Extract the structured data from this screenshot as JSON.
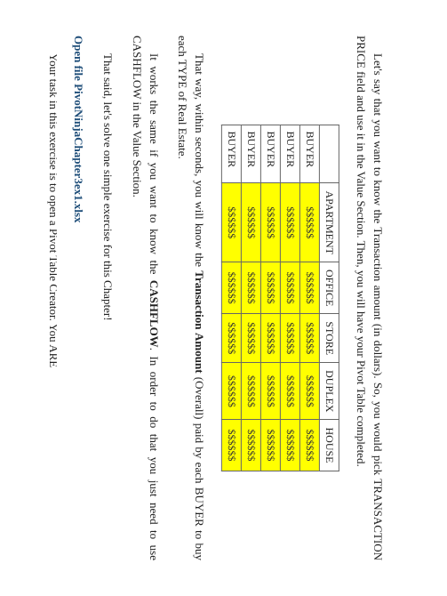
{
  "para1": "Let's say that you want to know the Transaction amount (in dollars). So, you would pick TRANSACTION PRICE field and use it in the Value Section. Then, you will have your Pivot Table completed.",
  "table": {
    "headers": [
      "",
      "APARTMENT",
      "OFFICE",
      "STORE",
      "DUPLEX",
      "HOUSE"
    ],
    "rowLabel": "BUYER",
    "cellValue": "$$$$$$",
    "rowCount": 5
  },
  "para2a": "That way, within seconds, you will know the ",
  "para2b": "Transaction Amount",
  "para2c": " (Overall) paid by each BUYER to buy each TYPE of Real Estate.",
  "para3a": "It works the same if you want to know the ",
  "para3b": "CASHFLOW",
  "para3c": ". In order to do that you just need to use CASHFLOW in the Value Section.",
  "para4": "That said, let's solve one simple exercise for this Chapter!",
  "linkText": "Open file PivotNinjaChapter3ex1.xlsx",
  "cutoff": "Your task in this exercise is to open a Pivot Table Creator. You ARE"
}
